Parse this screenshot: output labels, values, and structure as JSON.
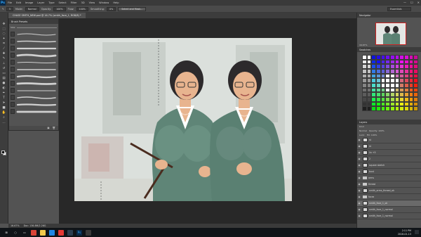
{
  "app": {
    "logo": "Ps",
    "menu": [
      "File",
      "Edit",
      "Image",
      "Layer",
      "Type",
      "Select",
      "Filter",
      "3D",
      "View",
      "Window",
      "Help"
    ],
    "window_controls": [
      "—",
      "☐",
      "✕"
    ]
  },
  "options": {
    "brush_size": "5",
    "mode_label": "Mode:",
    "mode_value": "Normal",
    "opacity_label": "Opacity:",
    "opacity_value": "100%",
    "flow_label": "Flow:",
    "flow_value": "100%",
    "smoothing_label": "Smoothing:",
    "smoothing_value": "0%",
    "select_mask_button": "Select and Mask...",
    "workspace": "Essentials"
  },
  "document": {
    "tab_title": "CHASE SMITH_NEW.psd @ 16.7% (smith_face_1, RGB/8) *"
  },
  "brush_presets": {
    "title": "Brush Presets",
    "size_label": "Size:"
  },
  "status": {
    "zoom": "16.67%",
    "doc_info": "Doc: 136.8M/2.26G"
  },
  "panels": {
    "navigator": "Navigator",
    "navigator_zoom": "16.67%",
    "swatches": "Swatches",
    "layers": "Layers",
    "kind_label": "Kind",
    "blend": "Normal",
    "opacity": "Opacity: 100%",
    "fill": "Fill: 100%",
    "lock": "Lock:"
  },
  "layers": [
    {
      "name": "st",
      "type": "layer"
    },
    {
      "name": "st",
      "type": "layer"
    },
    {
      "name": "lin +5",
      "type": "layer"
    },
    {
      "name": "2",
      "type": "layer"
    },
    {
      "name": "square sketch",
      "type": "layer"
    },
    {
      "name": "bust",
      "type": "layer"
    },
    {
      "name": "arms",
      "type": "folder"
    },
    {
      "name": "thread",
      "type": "folder"
    },
    {
      "name": "smith_arms_thread_ok",
      "type": "layer"
    },
    {
      "name": "faces",
      "type": "folder"
    },
    {
      "name": "smith_face_1_ok",
      "type": "layer"
    },
    {
      "name": "smith_face_1_normal",
      "type": "layer"
    },
    {
      "name": "smith_face_1_normal",
      "type": "layer"
    }
  ],
  "taskbar": {
    "time": "2:11 PM",
    "date": "2018-01-13"
  },
  "colors": {
    "ui_dark": "#3a3a3a",
    "ui_panel": "#535353",
    "workspace_bg": "#282828",
    "suit": "#5f8577",
    "hair": "#2d2a2c",
    "skin": "#e8b48f"
  }
}
